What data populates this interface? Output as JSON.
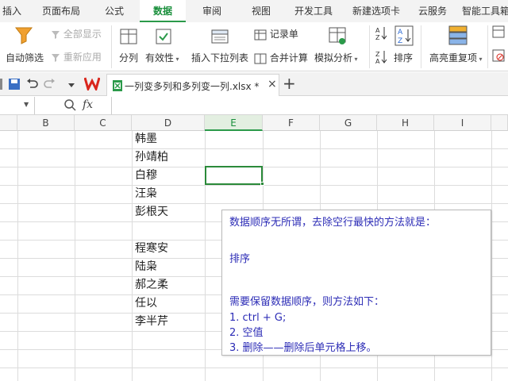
{
  "menu": {
    "tabs": [
      "插入",
      "页面布局",
      "公式",
      "数据",
      "审阅",
      "视图",
      "开发工具",
      "新建选项卡",
      "云服务",
      "智能工具箱"
    ],
    "active": "数据"
  },
  "ribbon": {
    "autofilter": "自动筛选",
    "show_all": "全部显示",
    "reapply": "重新应用",
    "split": "分列",
    "validity": "有效性",
    "dropdown_list": "插入下拉列表",
    "record_list": "记录单",
    "merge_calc": "合并计算",
    "simulate": "模拟分析",
    "sort": "排序",
    "highlight_dup": "高亮重复项"
  },
  "doc": {
    "filename": "一列变多列和多列变一列.xlsx *",
    "new_tab": "+",
    "close": "×"
  },
  "formula_bar": {
    "fx": "fx",
    "name_box": "",
    "content": ""
  },
  "sheet": {
    "columns": [
      "B",
      "C",
      "D",
      "E",
      "F",
      "G",
      "H",
      "I"
    ],
    "selected_column": "E",
    "column_d": [
      "韩墨",
      "孙靖柏",
      "白穆",
      "汪枭",
      "彭根天",
      "",
      "程寒安",
      "陆枭",
      "郝之柔",
      "任以",
      "李半芹"
    ]
  },
  "comment": {
    "line1": "数据顺序无所谓，去除空行最快的方法就是：",
    "line2": "排序",
    "line3": "需要保留数据顺序，则方法如下：",
    "line4": "1. ctrl + G;",
    "line5": "2. 空值",
    "line6": "3. 删除——删除后单元格上移。"
  },
  "colors": {
    "accent": "#2b9a4a",
    "comment_text": "#2c2cb6",
    "wps_red": "#d9261c"
  }
}
